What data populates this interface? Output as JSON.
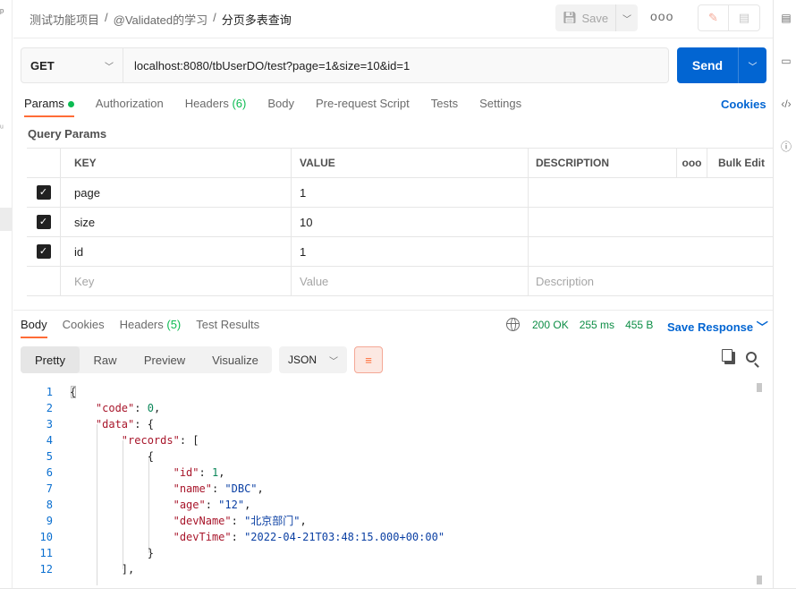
{
  "breadcrumb": {
    "workspace": "测试功能项目",
    "collection": "@Validated的学习",
    "request": "分页多表查询",
    "separator": "/"
  },
  "header": {
    "save_label": "Save",
    "more_label": "ooo"
  },
  "request": {
    "method": "GET",
    "url": "localhost:8080/tbUserDO/test?page=1&size=10&id=1",
    "send_label": "Send"
  },
  "request_tabs": [
    {
      "label": "Params",
      "count": ""
    },
    {
      "label": "Authorization",
      "count": ""
    },
    {
      "label": "Headers",
      "count": "(6)"
    },
    {
      "label": "Body",
      "count": ""
    },
    {
      "label": "Pre-request Script",
      "count": ""
    },
    {
      "label": "Tests",
      "count": ""
    },
    {
      "label": "Settings",
      "count": ""
    }
  ],
  "cookies_label": "Cookies",
  "query_params": {
    "title": "Query Params",
    "headers": {
      "key": "KEY",
      "value": "VALUE",
      "description": "DESCRIPTION",
      "more": "ooo",
      "bulk_edit": "Bulk Edit"
    },
    "rows": [
      {
        "key": "page",
        "value": "1",
        "checked": true
      },
      {
        "key": "size",
        "value": "10",
        "checked": true
      },
      {
        "key": "id",
        "value": "1",
        "checked": true
      }
    ],
    "placeholders": {
      "key": "Key",
      "value": "Value",
      "description": "Description"
    }
  },
  "response": {
    "tabs": [
      {
        "label": "Body",
        "count": ""
      },
      {
        "label": "Cookies",
        "count": ""
      },
      {
        "label": "Headers",
        "count": "(5)"
      },
      {
        "label": "Test Results",
        "count": ""
      }
    ],
    "status": "200 OK",
    "time": "255 ms",
    "size": "455 B",
    "save_label": "Save Response",
    "view_tabs": [
      "Pretty",
      "Raw",
      "Preview",
      "Visualize"
    ],
    "format": "JSON",
    "lines": [
      {
        "n": "1"
      },
      {
        "n": "2"
      },
      {
        "n": "3"
      },
      {
        "n": "4"
      },
      {
        "n": "5"
      },
      {
        "n": "6"
      },
      {
        "n": "7"
      },
      {
        "n": "8"
      },
      {
        "n": "9"
      },
      {
        "n": "10"
      },
      {
        "n": "11"
      },
      {
        "n": "12"
      }
    ],
    "body": {
      "code_key": "\"code\"",
      "code_val": "0",
      "data_key": "\"data\"",
      "records_key": "\"records\"",
      "id_key": "\"id\"",
      "id_val": "1",
      "name_key": "\"name\"",
      "name_val": "\"DBC\"",
      "age_key": "\"age\"",
      "age_val": "\"12\"",
      "devName_key": "\"devName\"",
      "devName_val": "\"北京部门\"",
      "devTime_key": "\"devTime\"",
      "devTime_val": "\"2022-04-21T03:48:15.000+00:00\""
    }
  },
  "colors": {
    "accent": "#ff6c37",
    "primary": "#0265d2",
    "success": "#0cbb52"
  }
}
